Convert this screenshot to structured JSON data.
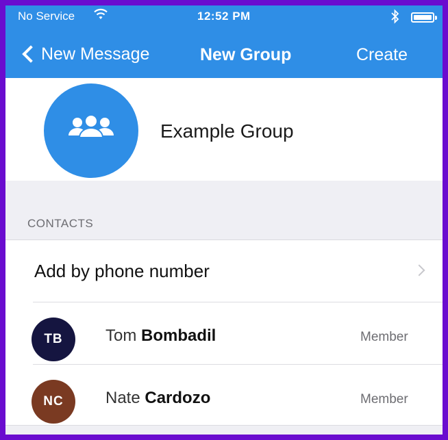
{
  "status_bar": {
    "carrier": "No Service",
    "time": "12:52 PM"
  },
  "nav": {
    "back_label": "New Message",
    "title": "New Group",
    "action_label": "Create"
  },
  "group": {
    "name": "Example Group",
    "icon": "group-people-icon"
  },
  "contacts_section": {
    "header": "CONTACTS",
    "add_row_label": "Add by phone number",
    "items": [
      {
        "initials": "TB",
        "first": "Tom",
        "last": "Bombadil",
        "badge": "Member",
        "avatar_color": "#151540"
      },
      {
        "initials": "NC",
        "first": "Nate",
        "last": "Cardozo",
        "badge": "Member",
        "avatar_color": "#7a3a22"
      }
    ]
  },
  "colors": {
    "accent": "#2f8ee6",
    "frame_border": "#6a0ccf",
    "section_background": "#efeff4"
  }
}
